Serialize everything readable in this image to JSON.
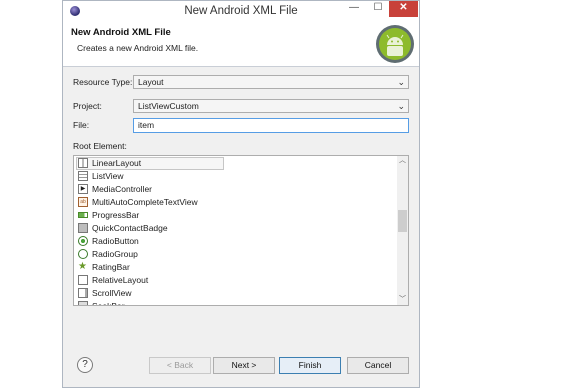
{
  "window": {
    "title": "New Android XML File",
    "close_symbol": "✕",
    "min_symbol": "—",
    "max_symbol": "☐"
  },
  "banner": {
    "title": "New Android XML File",
    "description": "Creates a new Android XML file."
  },
  "form": {
    "resource_type_label": "Resource Type:",
    "resource_type_value": "Layout",
    "project_label": "Project:",
    "project_value": "ListViewCustom",
    "file_label": "File:",
    "file_value": "item",
    "root_element_label": "Root Element:"
  },
  "root_elements": [
    {
      "label": "LinearLayout",
      "icon": "linear-layout-icon",
      "selected": true
    },
    {
      "label": "ListView",
      "icon": "list-view-icon"
    },
    {
      "label": "MediaController",
      "icon": "media-controller-icon"
    },
    {
      "label": "MultiAutoCompleteTextView",
      "icon": "multi-autocomplete-icon"
    },
    {
      "label": "ProgressBar",
      "icon": "progress-bar-icon"
    },
    {
      "label": "QuickContactBadge",
      "icon": "quick-contact-badge-icon"
    },
    {
      "label": "RadioButton",
      "icon": "radio-button-icon"
    },
    {
      "label": "RadioGroup",
      "icon": "radio-group-icon"
    },
    {
      "label": "RatingBar",
      "icon": "rating-bar-icon"
    },
    {
      "label": "RelativeLayout",
      "icon": "relative-layout-icon"
    },
    {
      "label": "ScrollView",
      "icon": "scroll-view-icon"
    },
    {
      "label": "SeekBar",
      "icon": "seek-bar-icon"
    }
  ],
  "buttons": {
    "help": "?",
    "back": "< Back",
    "next": "Next >",
    "finish": "Finish",
    "cancel": "Cancel"
  },
  "colors": {
    "accent": "#3c7fb1",
    "close": "#c8413a",
    "android_green": "#8dbb2c"
  }
}
